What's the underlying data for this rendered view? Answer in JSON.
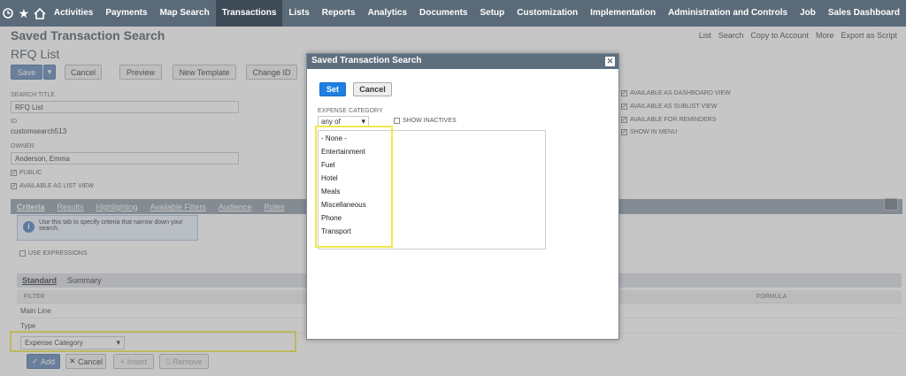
{
  "nav": {
    "items": [
      "Activities",
      "Payments",
      "Map Search",
      "Transactions",
      "Lists",
      "Reports",
      "Analytics",
      "Documents",
      "Setup",
      "Customization",
      "Implementation",
      "Administration and Controls",
      "Job",
      "Sales Dashboard"
    ],
    "active": "Transactions",
    "icons": [
      "history-icon",
      "star-icon",
      "home-icon"
    ]
  },
  "header": {
    "title": "Saved Transaction Search",
    "subtitle": "RFQ List",
    "actions": [
      "List",
      "Search",
      "Copy to Account",
      "More",
      "Export as Script"
    ]
  },
  "toolbar": {
    "save": "Save",
    "cancel": "Cancel",
    "preview": "Preview",
    "new_template": "New Template",
    "change_id": "Change ID"
  },
  "form": {
    "search_title_label": "SEARCH TITLE",
    "search_title_value": "RFQ List",
    "id_label": "ID",
    "id_value": "customsearch513",
    "owner_label": "OWNER",
    "owner_value": "Anderson, Emma",
    "public_label": "PUBLIC",
    "list_view_label": "AVAILABLE AS LIST VIEW",
    "right_checks": [
      "AVAILABLE AS DASHBOARD VIEW",
      "AVAILABLE AS SUBLIST VIEW",
      "AVAILABLE FOR REMINDERS",
      "SHOW IN MENU"
    ]
  },
  "tabs": [
    "Criteria",
    "Results",
    "Highlighting",
    "Available Filters",
    "Audience",
    "Roles"
  ],
  "criteria": {
    "info": "Use this tab to specify criteria that narrow down your search.",
    "use_expressions": "USE EXPRESSIONS",
    "subtabs": [
      "Standard",
      "Summary"
    ],
    "filter_header": "FILTER",
    "formula_header": "FORMULA",
    "rows": [
      "Main Line",
      "Type"
    ],
    "selected_filter": "Expense Category",
    "row_buttons": [
      "Add",
      "Cancel",
      "Insert",
      "Remove"
    ]
  },
  "modal": {
    "title": "Saved Transaction Search",
    "set": "Set",
    "cancel": "Cancel",
    "category_label": "EXPENSE CATEGORY",
    "operator": "any of",
    "show_inactives": "SHOW INACTIVES",
    "options": [
      "- None -",
      "Entertainment",
      "Fuel",
      "Hotel",
      "Meals",
      "Miscellaneous",
      "Phone",
      "Transport"
    ]
  },
  "colors": {
    "nav_bg": "#5a6a78",
    "highlight": "#f0e94b",
    "set_button": "#1e7fe0"
  }
}
